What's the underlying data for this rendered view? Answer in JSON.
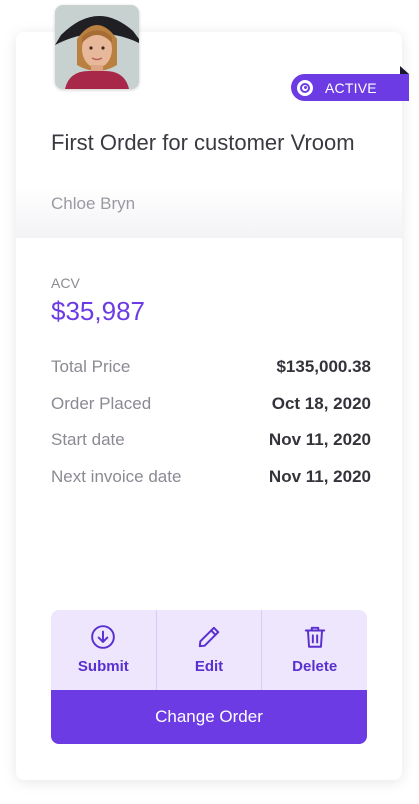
{
  "order": {
    "status": "ACTIVE",
    "title": "First Order for customer Vroom",
    "customer": "Chloe Bryn"
  },
  "acv": {
    "label": "ACV",
    "value": "$35,987"
  },
  "details": [
    {
      "label": "Total Price",
      "value": "$135,000.38"
    },
    {
      "label": "Order Placed",
      "value": "Oct 18, 2020"
    },
    {
      "label": "Start date",
      "value": "Nov 11, 2020"
    },
    {
      "label": "Next invoice date",
      "value": "Nov 11, 2020"
    }
  ],
  "actions": {
    "submit": {
      "label": "Submit",
      "icon": "download-circle-icon"
    },
    "edit": {
      "label": "Edit",
      "icon": "pencil-icon"
    },
    "delete": {
      "label": "Delete",
      "icon": "trash-icon"
    }
  },
  "primary_button": "Change Order",
  "colors": {
    "accent": "#6c3be4",
    "action_bg": "#ede6fc",
    "text_dark": "#33333a",
    "text_muted": "#8a8a92"
  }
}
